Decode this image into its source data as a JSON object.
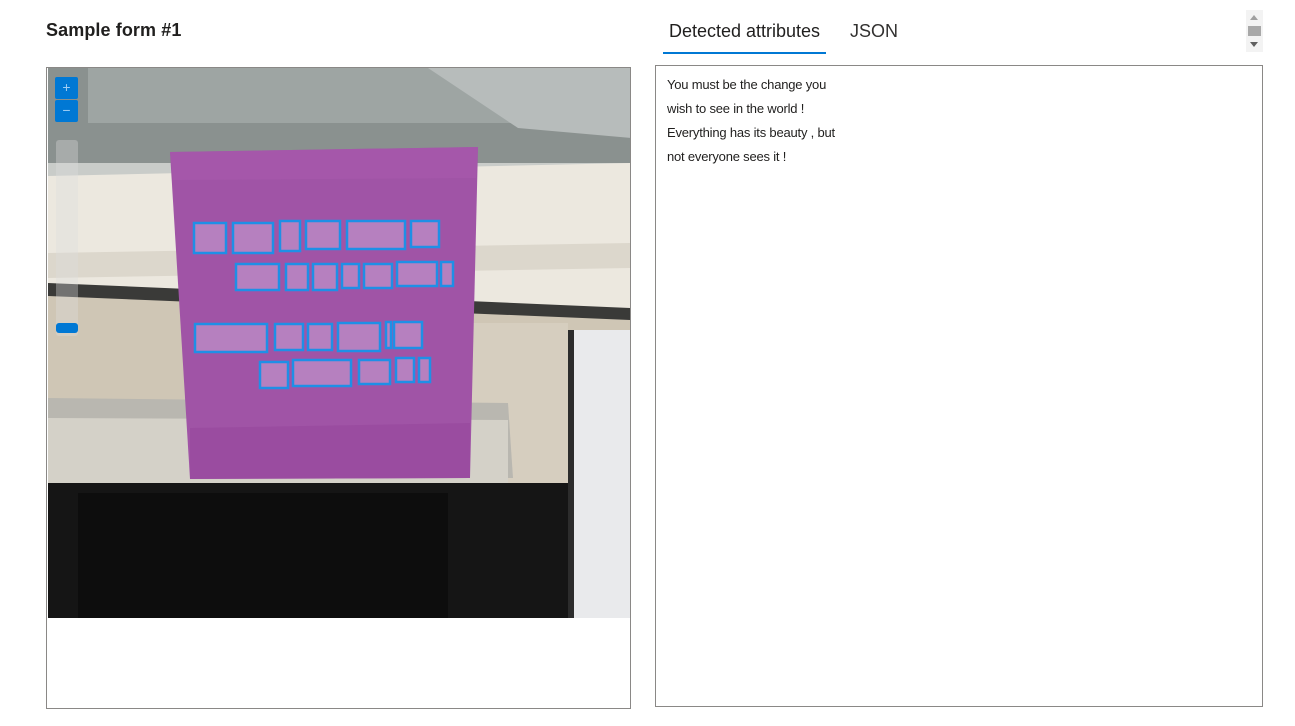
{
  "form": {
    "title": "Sample form #1"
  },
  "viewer": {
    "zoom_in_label": "+",
    "zoom_out_label": "−",
    "zoom_level": 0.2
  },
  "tabs": [
    {
      "label": "Detected attributes",
      "active": true
    },
    {
      "label": "JSON",
      "active": false
    }
  ],
  "result": {
    "lines": [
      "You must be the change you",
      "wish to see in the world !",
      "Everything has its beauty , but",
      "not everyone sees it !"
    ]
  },
  "colors": {
    "accent": "#0078d4",
    "note_paper": "#a054a6",
    "word_box": "#1f8fe6"
  }
}
